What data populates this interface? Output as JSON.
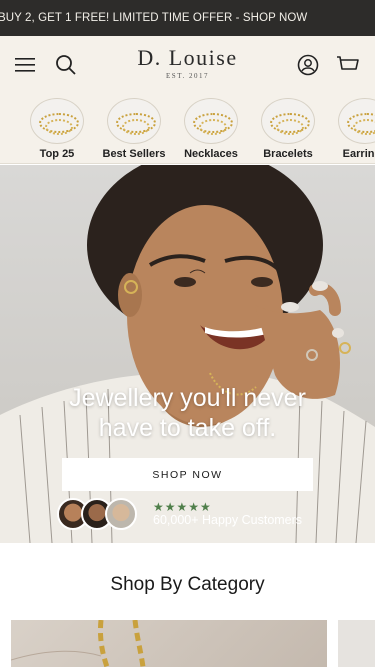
{
  "announcement": {
    "text": "BUY 2, GET 1 FREE! LIMITED TIME OFFER - SHOP NOW"
  },
  "header": {
    "logo_main": "D. Louise",
    "logo_sub": "EST. 2017",
    "icons": [
      "menu-icon",
      "search-icon",
      "account-icon",
      "cart-icon"
    ]
  },
  "categories": [
    {
      "label": "Top 25"
    },
    {
      "label": "Best Sellers"
    },
    {
      "label": "Necklaces"
    },
    {
      "label": "Bracelets"
    },
    {
      "label": "Earrings"
    }
  ],
  "hero": {
    "title_line1": "Jewellery you'll never",
    "title_line2": "have to take off.",
    "button_label": "SHOP NOW",
    "rating_stars": "★★★★★",
    "customers_text": "60,000+ Happy Customers"
  },
  "shop_by_category": {
    "title": "Shop By Category"
  },
  "colors": {
    "announcement_bg": "#2d2c2a",
    "header_bg": "#f5f1ea",
    "star_green": "#4f7f4a",
    "gold": "#c9a13d"
  }
}
